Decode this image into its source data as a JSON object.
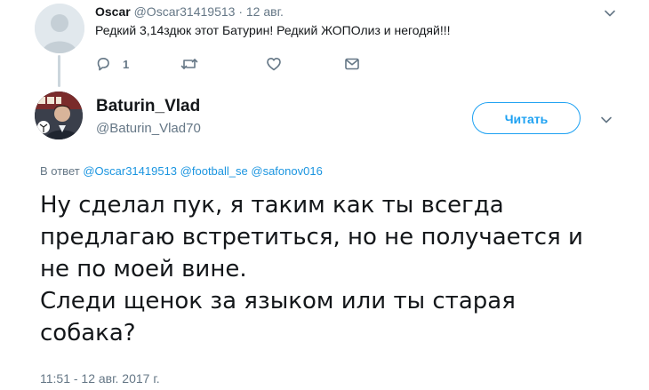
{
  "parent_tweet": {
    "name": "Oscar",
    "handle": "@Oscar31419513",
    "separator": "·",
    "date": "12 авг.",
    "text": "Редкий 3,14здюк этот Батурин! Редкий ЖОПОлиз и негодяй!!!",
    "actions": {
      "reply_icon": "reply-icon",
      "reply_count": "1",
      "retweet_icon": "retweet-icon",
      "like_icon": "heart-icon",
      "dm_icon": "envelope-icon"
    }
  },
  "main_tweet": {
    "name": "Baturin_Vlad",
    "handle": "@Baturin_Vlad70",
    "follow_label": "Читать",
    "reply_prefix": "В ответ",
    "reply_mentions": [
      "@Oscar31419513",
      "@football_se",
      "@safonov016"
    ],
    "text_lines": [
      "Ну сделал пук, я таким как ты всегда",
      "предлагаю встретиться, но не получается и",
      "не по моей вине.",
      "Следи щенок за языком или ты старая",
      "собака?"
    ],
    "timestamp": "11:51 - 12 авг. 2017 г."
  },
  "colors": {
    "accent": "#1da1f2",
    "link": "#1b95e0",
    "muted": "#657786",
    "text": "#14171a",
    "thread_line": "#ccd6dd"
  }
}
